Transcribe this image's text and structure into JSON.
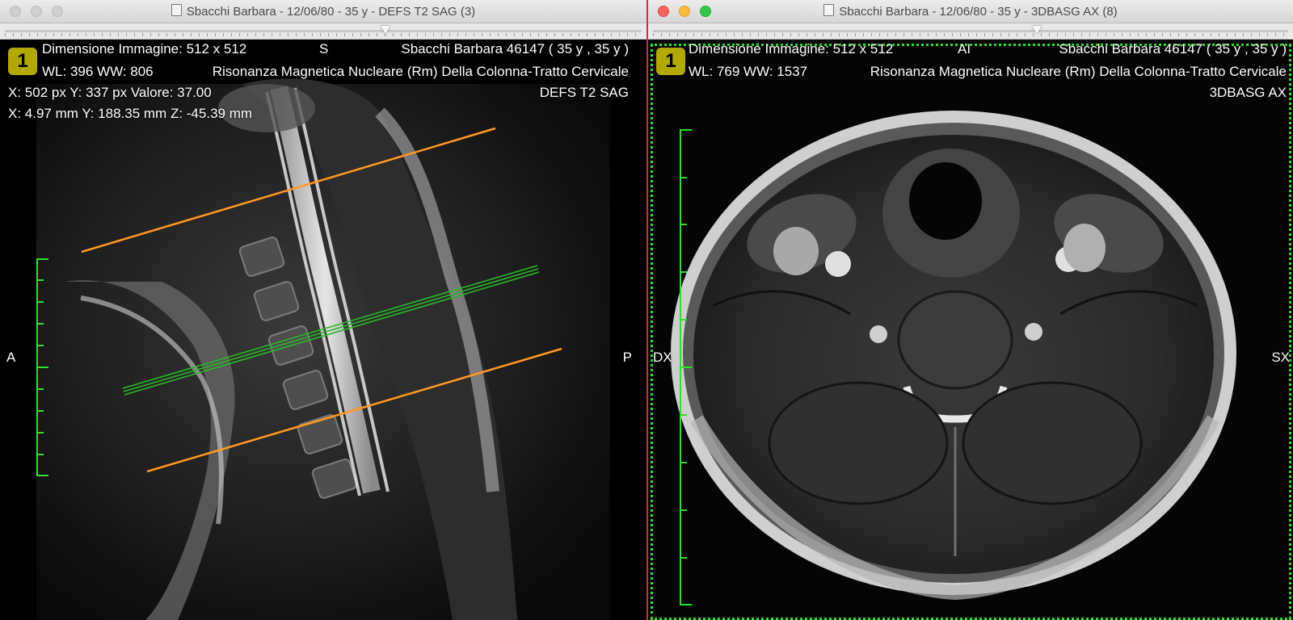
{
  "left": {
    "title": "Sbacchi Barbara - 12/06/80 - 35 y - DEFS T2 SAG (3)",
    "badge": "1",
    "overlay": {
      "dimension": "Dimensione Immagine: 512 x 512",
      "orientation_top": "S",
      "patient": "Sbacchi Barbara 46147 ( 35 y , 35 y )",
      "wl": "WL: 396 WW: 806",
      "study": "Risonanza Magnetica Nucleare (Rm) Della Colonna-Tratto Cervicale",
      "pixel": "X: 502 px Y: 337 px Valore: 37.00",
      "mm": "X: 4.97 mm Y: 188.35 mm Z: -45.39 mm",
      "series": "DEFS T2 SAG",
      "orientation_left": "A",
      "orientation_right": "P"
    }
  },
  "right": {
    "title": "Sbacchi Barbara - 12/06/80 - 35 y - 3DBASG AX (8)",
    "badge": "1",
    "overlay": {
      "dimension": "Dimensione Immagine: 512 x 512",
      "orientation_top": "AI",
      "patient": "Sbacchi Barbara 46147 ( 35 y , 35 y )",
      "wl": "WL: 769 WW: 1537",
      "study": "Risonanza Magnetica Nucleare (Rm) Della Colonna-Tratto Cervicale",
      "series": "3DBASG AX",
      "orientation_left": "DX",
      "orientation_right": "SX"
    }
  },
  "colors": {
    "accent_green": "#2ee02e",
    "scout_line": "#ff9a1f",
    "badge": "#b3a800",
    "active_border": "#cc3333"
  },
  "icons": [
    "document-icon",
    "close-icon",
    "minimize-icon",
    "zoom-icon"
  ]
}
